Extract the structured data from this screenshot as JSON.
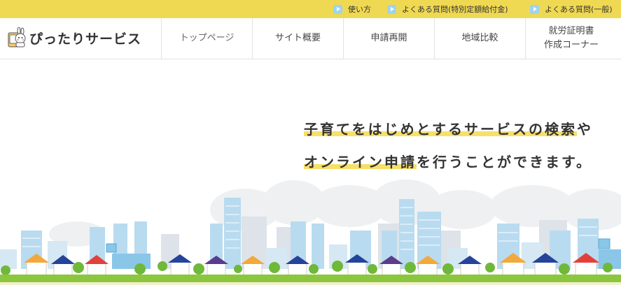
{
  "topbar": {
    "links": [
      {
        "label": "使い方"
      },
      {
        "label": "よくある質問(特別定額給付金)"
      },
      {
        "label": "よくある質問(一般)"
      }
    ]
  },
  "header": {
    "logo_text": "ぴったりサービス",
    "nav": [
      {
        "line1": "トップページ",
        "line2": ""
      },
      {
        "line1": "サイト概要",
        "line2": ""
      },
      {
        "line1": "申請再開",
        "line2": ""
      },
      {
        "line1": "地域比較",
        "line2": ""
      },
      {
        "line1": "就労証明書",
        "line2": "作成コーナー"
      }
    ]
  },
  "hero": {
    "line1_highlight": "子育てをはじめとするサービスの検索",
    "line1_rest": "や",
    "line2_highlight": "オンライン申請",
    "line2_rest": "を行うことができます。"
  },
  "colors": {
    "topbar_bg": "#f0d952",
    "highlight": "#f6e06a",
    "icon_blue": "#9fd4ee",
    "grass": "#8cc63f"
  }
}
